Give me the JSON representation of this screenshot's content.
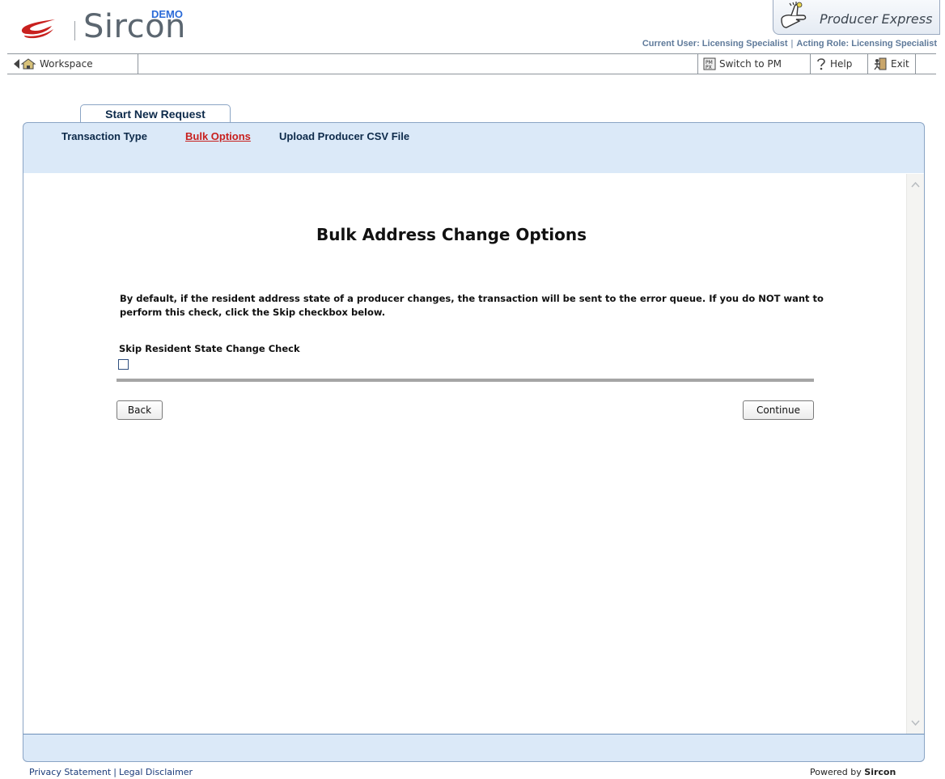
{
  "header": {
    "logo_text": "Sircon",
    "demo_badge": "DEMO",
    "product_name": "Producer Express",
    "current_user_label": "Current User: Licensing Specialist",
    "acting_role_label": "Acting Role: Licensing Specialist",
    "separator": "|"
  },
  "toolbar": {
    "workspace_label": "Workspace",
    "switch_label": "Switch to PM",
    "help_label": "Help",
    "exit_label": "Exit"
  },
  "tab": {
    "label": "Start New Request"
  },
  "subnav": {
    "items": [
      {
        "label": "Transaction Type",
        "active": false
      },
      {
        "label": "Bulk Options",
        "active": true
      },
      {
        "label": "Upload Producer CSV File",
        "active": false
      }
    ]
  },
  "main": {
    "heading": "Bulk Address Change Options",
    "description": "By default, if the resident address state of a producer changes, the transaction will be sent to the error queue. If you do NOT want to perform this check, click the Skip checkbox below.",
    "skip_label": "Skip Resident State Change Check",
    "skip_checked": false,
    "back_label": "Back",
    "continue_label": "Continue"
  },
  "footer": {
    "privacy_label": "Privacy Statement",
    "legal_label": "Legal Disclaimer",
    "separator": "|",
    "powered_prefix": "Powered by",
    "powered_brand": "Sircon"
  },
  "colors": {
    "active_link": "#c8201e",
    "panel_blue": "#dbe9f8",
    "nav_text": "#0d2a4a",
    "brand_red": "#c8201e",
    "demo_blue": "#2b6bd8"
  }
}
